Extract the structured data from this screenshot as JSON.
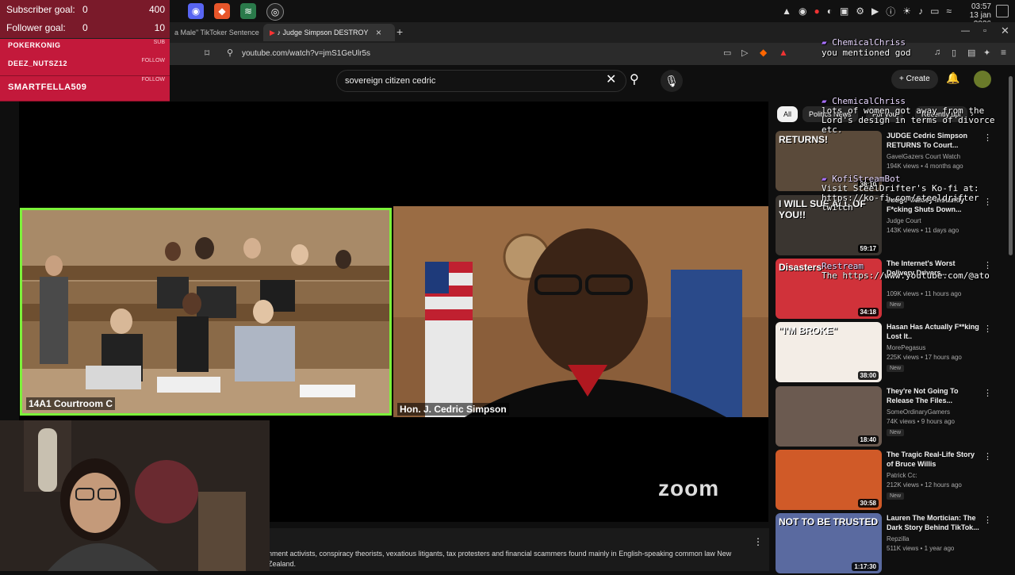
{
  "overlay": {
    "goals": [
      {
        "label": "Subscriber goal:",
        "current": "0",
        "target": "400"
      },
      {
        "label": "Follower goal:",
        "current": "0",
        "target": "10"
      }
    ],
    "alerts": [
      {
        "name": "POKERKONIG",
        "tag": "SUB"
      },
      {
        "name": "DEEZ_NUTSZ12",
        "tag": "FOLLOW"
      },
      {
        "name": "SMARTFELLA509",
        "tag": "FOLLOW"
      }
    ]
  },
  "taskbar": {
    "clock_time": "03:57",
    "clock_date": "13 jan 2026"
  },
  "browser": {
    "tabs": [
      {
        "title": "a Male\" TikToker Sentence"
      },
      {
        "title": "Judge Simpson DESTROY"
      }
    ],
    "new_tab": "+",
    "close_tab": "×",
    "url": "youtube.com/watch?v=jmS1GeUlr5s"
  },
  "youtube": {
    "search_value": "sovereign citizen cedric",
    "create_label": "Create",
    "video": {
      "tile1_label": "14A1 Courtroom C",
      "tile2_label": "Hon. J. Cedric Simpson",
      "zoom_logo": "zoom"
    },
    "description": "nment activists, conspiracy theorists, vexatious litigants, tax protesters and financial scammers found mainly in English-speaking common law New Zealand.",
    "chips": [
      "All",
      "Politics News",
      "For you",
      "Recently upl"
    ],
    "recommendations": [
      {
        "title": "JUDGE Cedric Simpson RETURNS To Court... ",
        "channel": "GavelGazers Court Watch",
        "meta": "194K views • 4 months ago",
        "duration": "38:10",
        "new": "",
        "thumb_color": "#5a4a3a",
        "thumb_text": "RETURNS!"
      },
      {
        "title": "Judge Oakley Instantly F*cking Shuts Down...",
        "channel": "Judge Court",
        "meta": "143K views • 11 days ago",
        "duration": "59:17",
        "new": "",
        "thumb_color": "#3a3530",
        "thumb_text": "I WILL SUE ALL OF YOU!!"
      },
      {
        "title": "The Internet's Worst Delivery Drivers...",
        "channel": "",
        "meta": "109K views • 11 hours ago",
        "duration": "34:18",
        "new": "New",
        "thumb_color": "#d0323a",
        "thumb_text": "Disasters"
      },
      {
        "title": "Hasan Has Actually F**king Lost It..",
        "channel": "MorePegasus",
        "meta": "225K views • 17 hours ago",
        "duration": "38:00",
        "new": "New",
        "thumb_color": "#f3ede6",
        "thumb_text": "\"I'M BROKE\""
      },
      {
        "title": "They're Not Going To Release The Files...",
        "channel": "SomeOrdinaryGamers",
        "meta": "74K views • 9 hours ago",
        "duration": "18:40",
        "new": "New",
        "thumb_color": "#6b5a50",
        "thumb_text": ""
      },
      {
        "title": "The Tragic Real-Life Story of Bruce Willis",
        "channel": "Patrick Cc:",
        "meta": "212K views • 12 hours ago",
        "duration": "30:58",
        "new": "New",
        "thumb_color": "#d05a28",
        "thumb_text": ""
      },
      {
        "title": "Lauren The Mortician: The Dark Story Behind TikTok...",
        "channel": "Repzilla",
        "meta": "511K views • 1 year ago",
        "duration": "1:17:30",
        "new": "",
        "thumb_color": "#5a6aa0",
        "thumb_text": "NOT TO BE TRUSTED"
      }
    ]
  },
  "chat": [
    {
      "user": "ChemicalChriss",
      "message": "you mentioned god"
    },
    {
      "user": "ChemicalChriss",
      "message": "lots of women got away from the Lord's design in terms of divorce etc."
    },
    {
      "user": "KofiStreamBot",
      "message": "Visit SteelDrifter's Ko-fi at: https://ko-fi.com/steeldrifter twitch"
    },
    {
      "user": "Restream",
      "message": "The https://www.youtube.com/@ato"
    }
  ]
}
